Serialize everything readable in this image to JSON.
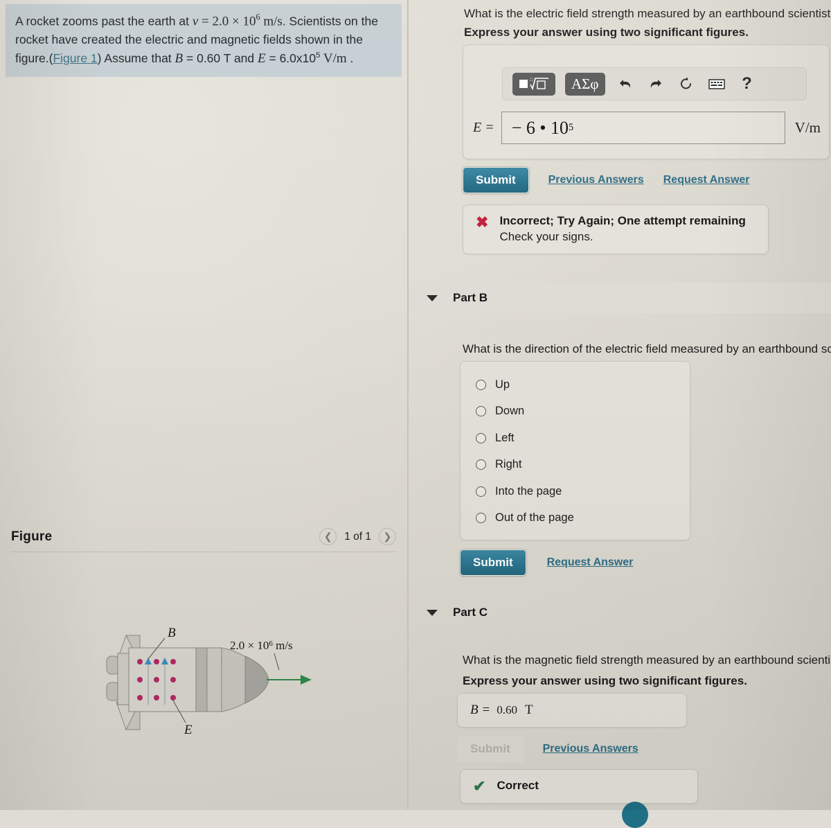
{
  "problem": {
    "text_part1": "A rocket zooms past the earth at ",
    "v_symbol": "v",
    "eq1": " = ",
    "v_value": "2.0 × 10",
    "v_exp": "6",
    "v_units": " m/s",
    "text_part2": ". Scientists on the rocket have created the electric and magnetic fields shown in the figure.(",
    "figure_link": "Figure 1",
    "text_part3": ") Assume that ",
    "B_symbol": "B",
    "B_value": " = 0.60 T",
    "text_and": " and ",
    "E_symbol": "E",
    "E_value": " = 6.0x10",
    "E_exp": "5",
    "E_units": " V/m",
    "text_end": " ."
  },
  "figure": {
    "title": "Figure",
    "page_label": "1 of 1",
    "prev_icon": "chevron-left-icon",
    "next_icon": "chevron-right-icon",
    "diagram": {
      "B_label": "B",
      "E_label": "E",
      "velocity_label": "2.0 × 10",
      "velocity_exp": "6",
      "velocity_units": " m/s"
    }
  },
  "part_a": {
    "question": "What is the electric field strength measured by an earthbound scientist?",
    "instruction": "Express your answer using two significant figures.",
    "toolbar": {
      "template_button": "▣√▢",
      "greek_button": "ΑΣφ",
      "undo_icon": "undo-arrow-icon",
      "redo_icon": "redo-arrow-icon",
      "reset_icon": "refresh-icon",
      "keyboard_icon": "keyboard-icon",
      "help_label": "?"
    },
    "answer_label": "E =",
    "answer_value": "− 6 • 10",
    "answer_exp": "5",
    "units": "V/m",
    "submit_label": "Submit",
    "previous_answers_label": "Previous Answers",
    "request_answer_label": "Request Answer",
    "feedback": {
      "icon": "x-mark-icon",
      "title": "Incorrect; Try Again; One attempt remaining",
      "subtitle": "Check your signs."
    }
  },
  "part_b": {
    "header_label": "Part B",
    "collapse_icon": "triangle-down-icon",
    "question": "What is the direction of the electric field measured by an earthbound scientis",
    "options": [
      {
        "label": "Up",
        "selected": false
      },
      {
        "label": "Down",
        "selected": false
      },
      {
        "label": "Left",
        "selected": false
      },
      {
        "label": "Right",
        "selected": false
      },
      {
        "label": "Into the page",
        "selected": false
      },
      {
        "label": "Out of the page",
        "selected": false
      }
    ],
    "submit_label": "Submit",
    "request_answer_label": "Request Answer"
  },
  "part_c": {
    "header_label": "Part C",
    "collapse_icon": "triangle-down-icon",
    "question": "What is the magnetic field strength measured by an earthbound scientist?",
    "instruction": "Express your answer using two significant figures.",
    "answer_label": "B =",
    "answer_value": "0.60",
    "units": "T",
    "submit_label": "Submit",
    "previous_answers_label": "Previous Answers",
    "feedback": {
      "icon": "check-mark-icon",
      "title": "Correct"
    }
  },
  "colors": {
    "page_bg": "#dedcd4",
    "problem_bg": "#c5ced2",
    "accent_teal": "#2c7590",
    "link": "#2f6e86",
    "incorrect_red": "#c2223f",
    "correct_green": "#2f7a4a",
    "field_dot_magenta": "#b32a62",
    "field_arrow_blue": "#3c8fc0",
    "velocity_arrow_green": "#2f8a4a"
  }
}
